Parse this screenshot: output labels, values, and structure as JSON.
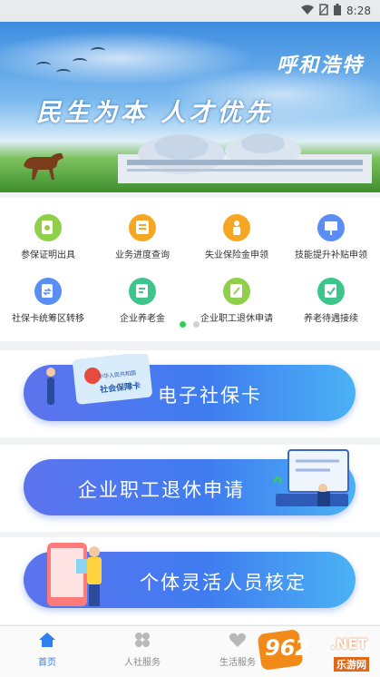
{
  "status_bar": {
    "time": "8:28"
  },
  "banner": {
    "city_title": "呼和浩特",
    "slogan": "民生为本  人才优先"
  },
  "services": [
    {
      "label": "参保证明出具",
      "icon": "certificate-icon",
      "color": "#8fcf4a"
    },
    {
      "label": "业务进度查询",
      "icon": "progress-form-icon",
      "color": "#f5a623"
    },
    {
      "label": "失业保险金申领",
      "icon": "unemployment-icon",
      "color": "#f5a623"
    },
    {
      "label": "技能提升补贴申领",
      "icon": "presentation-icon",
      "color": "#5a8ef5"
    },
    {
      "label": "社保卡统筹区转移",
      "icon": "transfer-doc-icon",
      "color": "#5a8ef5"
    },
    {
      "label": "企业养老金",
      "icon": "pension-doc-icon",
      "color": "#3dc58d"
    },
    {
      "label": "企业职工退休申请",
      "icon": "retire-edit-icon",
      "color": "#8fcf4a"
    },
    {
      "label": "养老待遇接续",
      "icon": "pension-continue-icon",
      "color": "#3dc58d"
    }
  ],
  "carousel": {
    "pages": 2,
    "active": 1
  },
  "cards": {
    "card1": {
      "label": "电子社保卡",
      "card_text": "社会保障卡",
      "card_subtext": "中华人民共和国"
    },
    "card2": {
      "label": "企业职工退休申请"
    },
    "card3": {
      "label": "个体灵活人员核定"
    }
  },
  "bottom_nav": [
    {
      "label": "首页",
      "icon": "home-icon",
      "active": true
    },
    {
      "label": "人社服务",
      "icon": "clover-icon",
      "active": false
    },
    {
      "label": "生活服务",
      "icon": "heart-icon",
      "active": false
    }
  ],
  "watermark": {
    "brand": "962",
    "suffix": ".NET",
    "sub": "乐游网"
  },
  "colors": {
    "accent": "#2f7ff0",
    "pill_start": "#5d73ee",
    "pill_end": "#4bb2f5",
    "dot_active": "#2ecc5a"
  }
}
